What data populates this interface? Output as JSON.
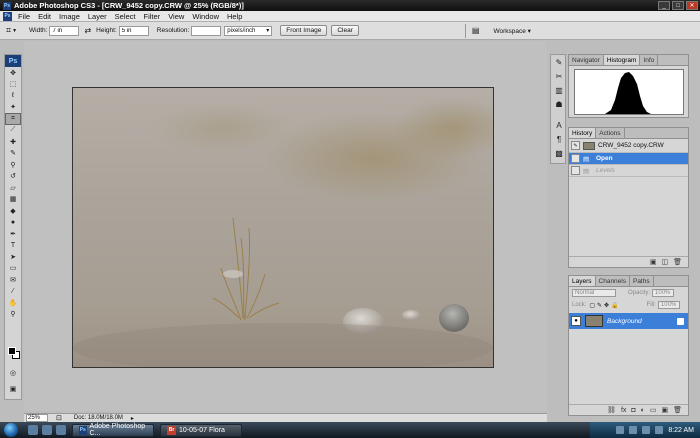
{
  "app": {
    "title": "Adobe Photoshop CS3 - [CRW_9452 copy.CRW @ 25% (RGB/8*)]",
    "ps_badge": "Ps"
  },
  "menu": [
    "File",
    "Edit",
    "Image",
    "Layer",
    "Select",
    "Filter",
    "View",
    "Window",
    "Help"
  ],
  "options": {
    "width_label": "Width:",
    "width_value": "7 in",
    "height_label": "Height:",
    "height_value": "5 in",
    "resolution_label": "Resolution:",
    "resolution_value": "",
    "resolution_unit": "pixels/inch",
    "front_image": "Front Image",
    "clear": "Clear",
    "workspace": "Workspace"
  },
  "status": {
    "zoom": "25%",
    "doc": "Doc: 18.0M/18.0M"
  },
  "nav_panel": {
    "tabs": [
      "Navigator",
      "Histogram",
      "Info"
    ],
    "active": 1
  },
  "history_panel": {
    "tabs": [
      "History",
      "Actions"
    ],
    "snapshot": "CRW_9452 copy.CRW",
    "items": [
      {
        "label": "Open",
        "selected": true
      },
      {
        "label": "Levels",
        "selected": false
      }
    ]
  },
  "layers_panel": {
    "tabs": [
      "Layers",
      "Channels",
      "Paths"
    ],
    "blend": "Normal",
    "opacity_label": "Opacity:",
    "opacity": "100%",
    "lock_label": "Lock:",
    "fill_label": "Fill:",
    "fill": "100%",
    "layer_name": "Background"
  },
  "taskbar": {
    "tasks": [
      "Adobe Photoshop C...",
      "10-05-07 Flora"
    ],
    "time": "8:22 AM"
  },
  "colors": {
    "selection": "#3b7fd9",
    "photo_sand": "#a9a29a"
  }
}
